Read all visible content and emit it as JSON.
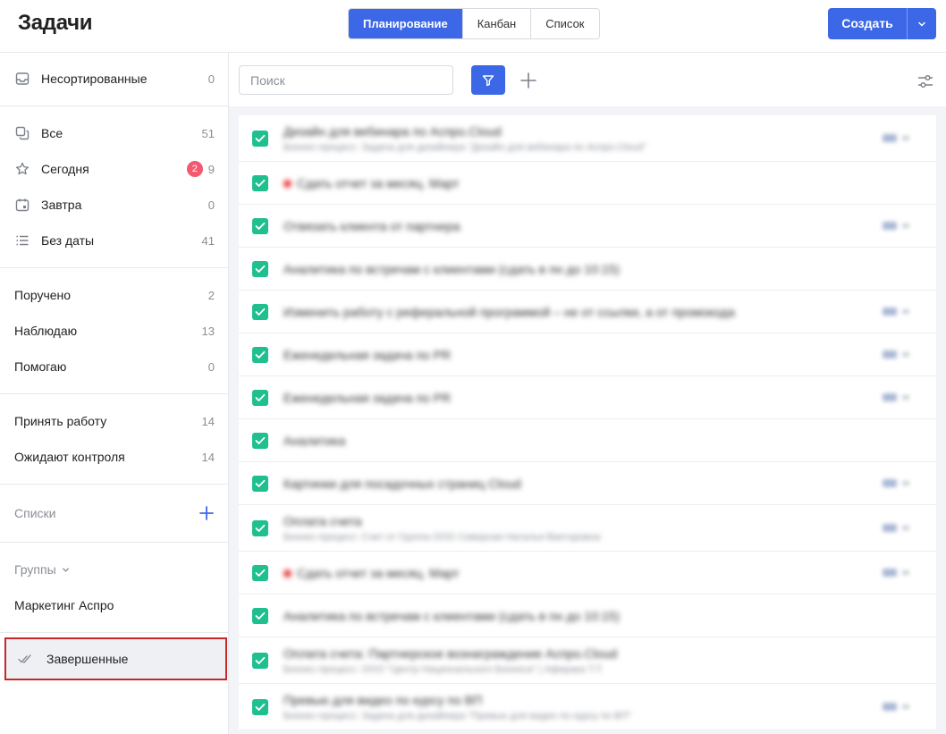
{
  "header": {
    "title": "Задачи",
    "tabs": [
      {
        "label": "Планирование",
        "active": true
      },
      {
        "label": "Канбан",
        "active": false
      },
      {
        "label": "Список",
        "active": false
      }
    ],
    "create_label": "Создать"
  },
  "colors": {
    "accent": "#3c68e8",
    "check": "#1fbf8f",
    "badge": "#f25a71",
    "highlight_border": "#c62828"
  },
  "sidebar": {
    "unsorted": {
      "label": "Несортированные",
      "count": "0",
      "icon": "inbox-icon"
    },
    "main": [
      {
        "label": "Все",
        "count": "51",
        "icon": "copy-icon"
      },
      {
        "label": "Сегодня",
        "count": "9",
        "badge": "2",
        "icon": "star-icon"
      },
      {
        "label": "Завтра",
        "count": "0",
        "icon": "calendar-icon"
      },
      {
        "label": "Без даты",
        "count": "41",
        "icon": "list-icon"
      }
    ],
    "roles": [
      {
        "label": "Поручено",
        "count": "2"
      },
      {
        "label": "Наблюдаю",
        "count": "13"
      },
      {
        "label": "Помогаю",
        "count": "0"
      }
    ],
    "control": [
      {
        "label": "Принять работу",
        "count": "14"
      },
      {
        "label": "Ожидают контроля",
        "count": "14"
      }
    ],
    "lists_label": "Списки",
    "groups_label": "Группы",
    "groups": [
      {
        "label": "Маркетинг Аспро"
      }
    ],
    "completed": {
      "label": "Завершенные",
      "icon": "double-check-icon"
    }
  },
  "toolbar": {
    "search_placeholder": "Поиск"
  },
  "tasks": [
    {
      "title": "Дизайн для вебинара по Аспро.Cloud",
      "subtitle": "Бизнес-процесс: Задача для дизайнера \"Дизайн для вебинара по Аспро.Cloud\"",
      "meta": true
    },
    {
      "title": "Сдать отчет за месяц. Март",
      "subtitle": "",
      "urgent": true,
      "meta": false
    },
    {
      "title": "Отвязать клиента от партнера",
      "subtitle": "",
      "meta": true
    },
    {
      "title": "Аналитика по встречам с клиентами (сдать в пн до 10:15)",
      "subtitle": "",
      "meta": false
    },
    {
      "title": "Изменить работу с реферальной программой – не от ссылки, а от промокода",
      "subtitle": "",
      "meta": true
    },
    {
      "title": "Еженедельная задача по PR",
      "subtitle": "",
      "meta": true
    },
    {
      "title": "Еженедельная задача по PR",
      "subtitle": "",
      "meta": true
    },
    {
      "title": "Аналитика",
      "subtitle": "",
      "meta": false
    },
    {
      "title": "Картинки для посадочных страниц Cloud",
      "subtitle": "",
      "meta": true
    },
    {
      "title": "Оплата счета",
      "subtitle": "Бизнес-процесс: Счет от Группа ООО Северная Наталья Викторовна",
      "meta": true
    },
    {
      "title": "Сдать отчет за месяц. Март",
      "subtitle": "",
      "urgent": true,
      "meta": true
    },
    {
      "title": "Аналитика по встречам с клиентами (сдать в пн до 10:15)",
      "subtitle": "",
      "meta": false
    },
    {
      "title": "Оплата счета: Партнерское вознаграждение Аспро.Cloud",
      "subtitle": "Бизнес-процесс: ООО \"Центр Национального Бизнеса\" | Аферака Т.Т.",
      "meta": false
    },
    {
      "title": "Превью для видео по курсу по ВП",
      "subtitle": "Бизнес-процесс: Задача для дизайнера \"Превью для видео по курсу по ВП\"",
      "meta": true
    }
  ]
}
